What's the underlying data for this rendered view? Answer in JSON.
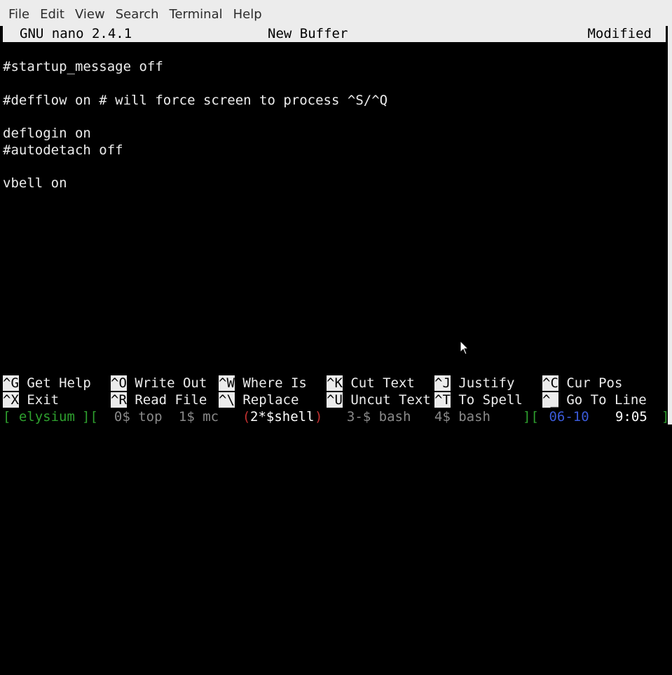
{
  "menubar": {
    "items": [
      "File",
      "Edit",
      "View",
      "Search",
      "Terminal",
      "Help"
    ]
  },
  "nano_title": {
    "version": "GNU nano 2.4.1",
    "buffer": "New Buffer",
    "status": "Modified"
  },
  "editor": {
    "lines": [
      "",
      "#startup_message off",
      "",
      "#defflow on # will force screen to process ^S/^Q",
      "",
      "deflogin on",
      "#autodetach off",
      "",
      "vbell on"
    ]
  },
  "shortcuts": {
    "row1": [
      {
        "key": "^G",
        "label": " Get Help"
      },
      {
        "key": "^O",
        "label": " Write Out"
      },
      {
        "key": "^W",
        "label": " Where Is"
      },
      {
        "key": "^K",
        "label": " Cut Text"
      },
      {
        "key": "^J",
        "label": " Justify"
      },
      {
        "key": "^C",
        "label": " Cur Pos"
      }
    ],
    "row2": [
      {
        "key": "^X",
        "label": " Exit"
      },
      {
        "key": "^R",
        "label": " Read File"
      },
      {
        "key": "^\\",
        "label": " Replace"
      },
      {
        "key": "^U",
        "label": " Uncut Text"
      },
      {
        "key": "^T",
        "label": " To Spell"
      },
      {
        "key": "^_",
        "label": " Go To Line"
      }
    ]
  },
  "screen_status": {
    "open_bracket": "[",
    "hostname": " elysium ",
    "sep1": "][",
    "win0": "  0$ top",
    "win1": "  1$ mc",
    "win2_open": "  (",
    "win2": "2*$shell",
    "win2_close": ")",
    "win3": "  3-$ bash",
    "win4": "  4$ bash",
    "sep2": "][",
    "date": " 06-10",
    "time": "9:05",
    "close_bracket": "]"
  },
  "colors": {
    "terminal_bg": "#000000",
    "terminal_fg": "#ececec",
    "screen_green": "#2ea02e",
    "screen_red": "#c23030",
    "screen_blue": "#3a5ad8"
  },
  "icons": {
    "pointer": "mouse-pointer-icon"
  }
}
